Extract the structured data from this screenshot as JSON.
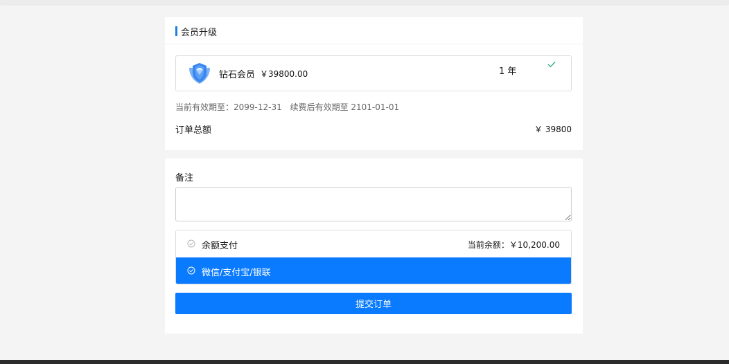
{
  "upgrade": {
    "title": "会员升级",
    "member": {
      "icon": "diamond-shield-icon",
      "name": "钻石会员",
      "price": "￥39800.00",
      "duration": "1 年",
      "check_icon": "check-icon"
    },
    "current_validity": "当前有效期至：2099-12-31",
    "renewed_validity": "续费后有效期至 2101-01-01",
    "total_label": "订单总额",
    "total_value": "￥ 39800"
  },
  "order": {
    "remark_label": "备注",
    "remark_value": "",
    "payment_methods": [
      {
        "label": "余额支付",
        "icon": "circle-check-icon",
        "selected": false
      },
      {
        "label": "微信/支付宝/银联",
        "icon": "circle-check-icon",
        "selected": true
      }
    ],
    "balance_info": "当前余额：￥10,200.00",
    "submit_label": "提交订单"
  },
  "colors": {
    "accent": "#0a7bff",
    "header_bar": "#1e7fe0",
    "background": "#f4f4f4"
  }
}
